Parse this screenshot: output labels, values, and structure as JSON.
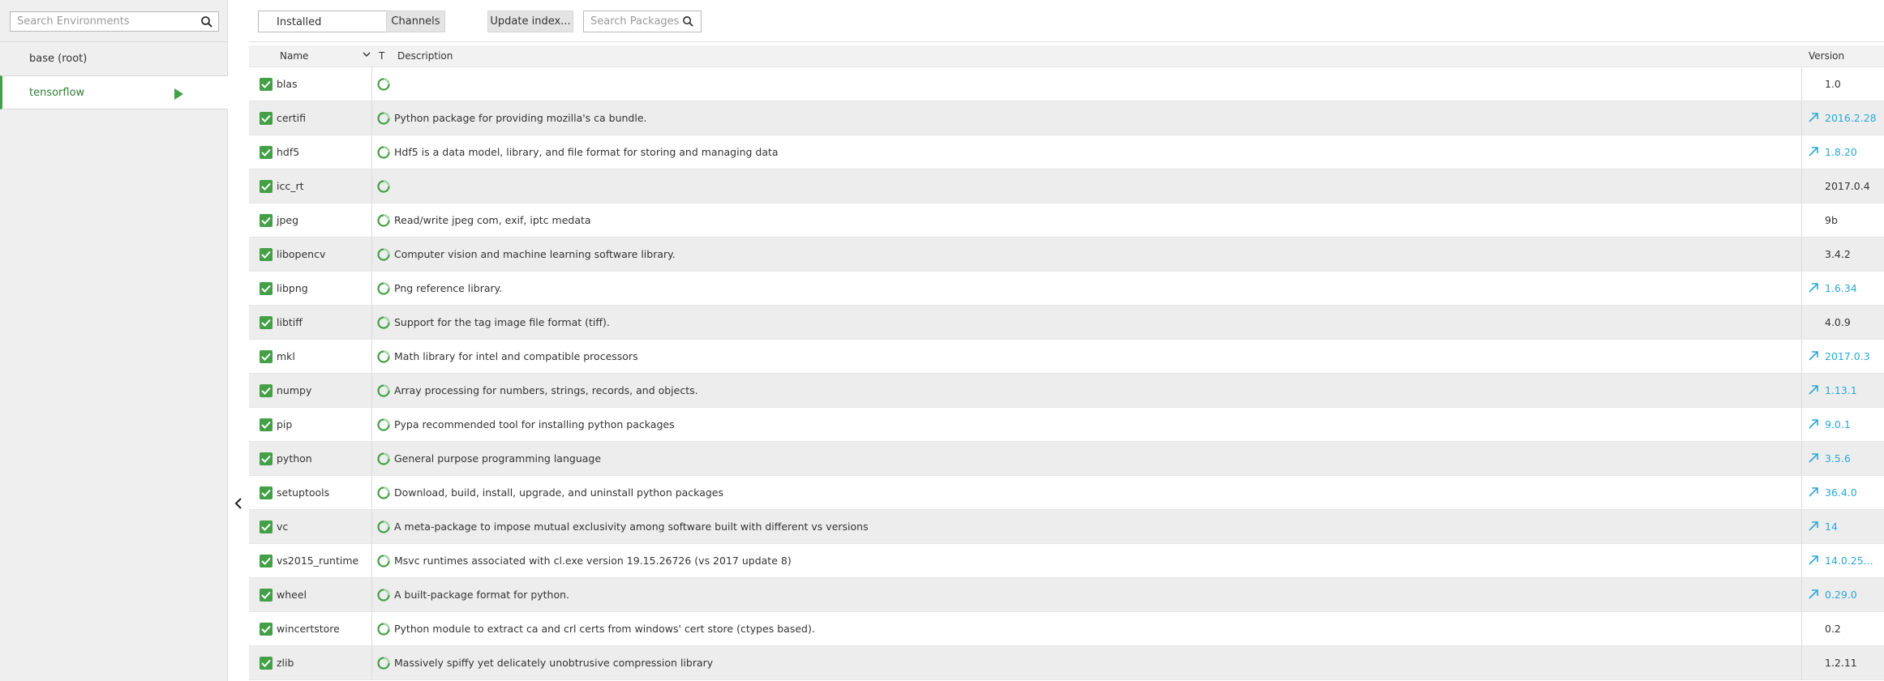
{
  "sidebar": {
    "search_placeholder": "Search Environments",
    "environments": [
      {
        "label": "base (root)",
        "active": false
      },
      {
        "label": "tensorflow",
        "active": true
      }
    ]
  },
  "toolbar": {
    "filter_value": "Installed",
    "channels_label": "Channels",
    "update_index_label": "Update index...",
    "package_search_placeholder": "Search Packages"
  },
  "table": {
    "headers": {
      "name": "Name",
      "type": "T",
      "description": "Description",
      "version": "Version"
    },
    "rows": [
      {
        "name": "blas",
        "description": "",
        "version": "1.0",
        "upgradable": false
      },
      {
        "name": "certifi",
        "description": "Python package for providing mozilla's ca bundle.",
        "version": "2016.2.28",
        "upgradable": true
      },
      {
        "name": "hdf5",
        "description": "Hdf5 is a data model, library, and file format for storing and managing data",
        "version": "1.8.20",
        "upgradable": true
      },
      {
        "name": "icc_rt",
        "description": "",
        "version": "2017.0.4",
        "upgradable": false
      },
      {
        "name": "jpeg",
        "description": "Read/write jpeg com, exif, iptc medata",
        "version": "9b",
        "upgradable": false
      },
      {
        "name": "libopencv",
        "description": "Computer vision and machine learning software library.",
        "version": "3.4.2",
        "upgradable": false
      },
      {
        "name": "libpng",
        "description": "Png reference library.",
        "version": "1.6.34",
        "upgradable": true
      },
      {
        "name": "libtiff",
        "description": "Support for the tag image file format (tiff).",
        "version": "4.0.9",
        "upgradable": false
      },
      {
        "name": "mkl",
        "description": "Math library for intel and compatible processors",
        "version": "2017.0.3",
        "upgradable": true
      },
      {
        "name": "numpy",
        "description": "Array processing for numbers, strings, records, and objects.",
        "version": "1.13.1",
        "upgradable": true
      },
      {
        "name": "pip",
        "description": "Pypa recommended tool for installing python packages",
        "version": "9.0.1",
        "upgradable": true
      },
      {
        "name": "python",
        "description": "General purpose programming language",
        "version": "3.5.6",
        "upgradable": true
      },
      {
        "name": "setuptools",
        "description": "Download, build, install, upgrade, and uninstall python packages",
        "version": "36.4.0",
        "upgradable": true
      },
      {
        "name": "vc",
        "description": "A meta-package to impose mutual exclusivity among software built with different vs versions",
        "version": "14",
        "upgradable": true
      },
      {
        "name": "vs2015_runtime",
        "description": "Msvc runtimes associated with cl.exe version 19.15.26726 (vs 2017 update 8)",
        "version": "14.0.25...",
        "upgradable": true
      },
      {
        "name": "wheel",
        "description": "A built-package format for python.",
        "version": "0.29.0",
        "upgradable": true
      },
      {
        "name": "wincertstore",
        "description": "Python module to extract ca and crl certs from windows' cert store (ctypes based).",
        "version": "0.2",
        "upgradable": false
      },
      {
        "name": "zlib",
        "description": "Massively spiffy yet delicately unobtrusive compression library",
        "version": "1.2.11",
        "upgradable": false
      }
    ]
  },
  "colors": {
    "accent_green": "#43a047",
    "upgrade_blue": "#29a8d6"
  }
}
